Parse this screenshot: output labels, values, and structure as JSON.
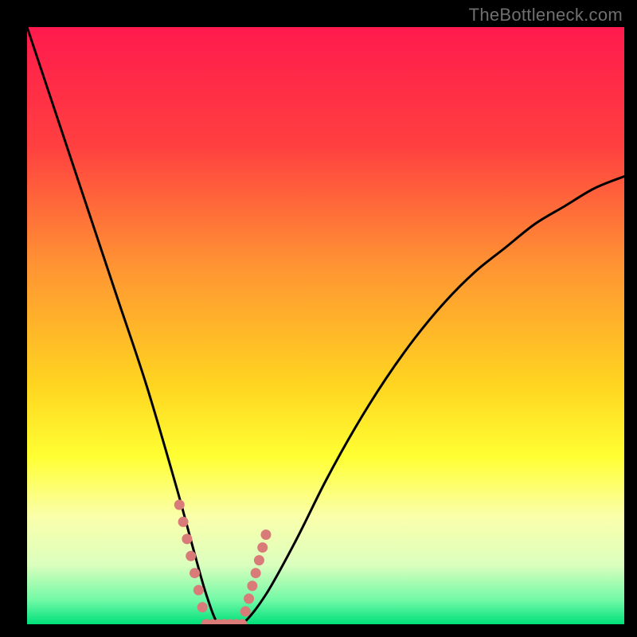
{
  "watermark": "TheBottleneck.com",
  "gradient": {
    "stops": [
      {
        "offset": 0.0,
        "color": "#ff1a4d"
      },
      {
        "offset": 0.2,
        "color": "#ff4040"
      },
      {
        "offset": 0.4,
        "color": "#ff9433"
      },
      {
        "offset": 0.6,
        "color": "#ffd520"
      },
      {
        "offset": 0.72,
        "color": "#ffff33"
      },
      {
        "offset": 0.82,
        "color": "#faffab"
      },
      {
        "offset": 0.9,
        "color": "#dcffbe"
      },
      {
        "offset": 0.96,
        "color": "#70f9a6"
      },
      {
        "offset": 1.0,
        "color": "#00e07a"
      }
    ]
  },
  "chart_data": {
    "type": "line",
    "title": "",
    "xlabel": "",
    "ylabel": "",
    "xlim": [
      0,
      100
    ],
    "ylim": [
      0,
      100
    ],
    "grid": false,
    "legend": false,
    "series": [
      {
        "name": "bottleneck-curve",
        "x": [
          0,
          5,
          10,
          15,
          20,
          25,
          28,
          30,
          32,
          34,
          36,
          40,
          45,
          50,
          55,
          60,
          65,
          70,
          75,
          80,
          85,
          90,
          95,
          100
        ],
        "y": [
          100,
          85,
          70,
          55,
          40,
          23,
          12,
          5,
          0,
          0,
          0,
          5,
          14,
          24,
          33,
          41,
          48,
          54,
          59,
          63,
          67,
          70,
          73,
          75
        ]
      }
    ],
    "dotted_segments": [
      {
        "x": [
          25.5,
          30.0
        ],
        "y": [
          20,
          0
        ]
      },
      {
        "x": [
          36.0,
          40.0
        ],
        "y": [
          0,
          15
        ]
      }
    ],
    "dot_color": "#d87b79",
    "curve_color": "#000000"
  }
}
